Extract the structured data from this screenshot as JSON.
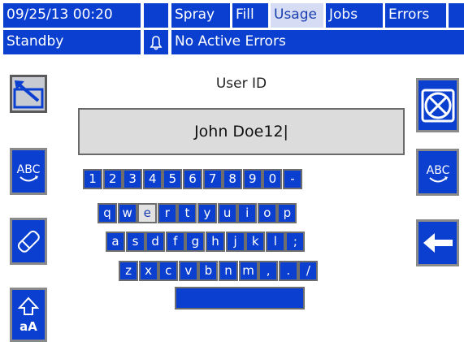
{
  "status_bar": {
    "datetime": "09/25/13 00:20",
    "tabs": [
      {
        "label": "Spray",
        "selected": false
      },
      {
        "label": "Fill",
        "selected": false
      },
      {
        "label": "Usage",
        "selected": true
      },
      {
        "label": "Jobs",
        "selected": false
      },
      {
        "label": "Errors",
        "selected": false
      }
    ],
    "mode": "Standby",
    "alarm_text": "No Active Errors"
  },
  "editor": {
    "field_label": "User ID",
    "field_value": "John Doe12|"
  },
  "left_buttons": [
    {
      "name": "exit-screen-button",
      "icon": "exit-screen-icon"
    },
    {
      "name": "toggle-keyboard-left-button",
      "icon": "abc-keyboard-icon",
      "text": "ABC"
    },
    {
      "name": "erase-button",
      "icon": "eraser-icon"
    },
    {
      "name": "shift-case-button",
      "icon": "shift-case-icon",
      "text": "aA"
    }
  ],
  "right_buttons": [
    {
      "name": "cancel-button",
      "icon": "cancel-x-icon"
    },
    {
      "name": "toggle-keyboard-right-button",
      "icon": "abc-keyboard-icon",
      "text": "ABC"
    },
    {
      "name": "backspace-button",
      "icon": "left-arrow-icon"
    }
  ],
  "keyboard": {
    "rows": [
      [
        "1",
        "2",
        "3",
        "4",
        "5",
        "6",
        "7",
        "8",
        "9",
        "0",
        "-"
      ],
      [
        "q",
        "w",
        "e",
        "r",
        "t",
        "y",
        "u",
        "i",
        "o",
        "p"
      ],
      [
        "a",
        "s",
        "d",
        "f",
        "g",
        "h",
        "j",
        "k",
        "l",
        ";"
      ],
      [
        "z",
        "x",
        "c",
        "v",
        "b",
        "n",
        "m",
        ",",
        ".",
        "/"
      ]
    ],
    "highlighted_key": "e"
  },
  "colors": {
    "accent_blue": "#0a3fd0",
    "selected_tab_bg": "#d6dcf4",
    "field_bg": "#dcdcdc",
    "key_border": "#6e6e6e"
  }
}
